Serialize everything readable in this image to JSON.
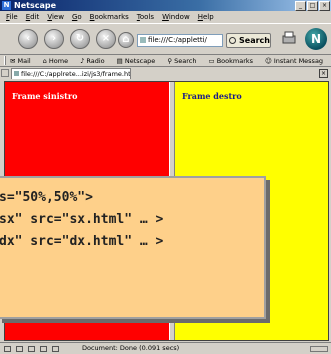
{
  "window": {
    "title": "Netscape"
  },
  "menubar": {
    "items": [
      "File",
      "Edit",
      "View",
      "Go",
      "Bookmarks",
      "Tools",
      "Window",
      "Help"
    ]
  },
  "navbar": {
    "url": "file:///C:/appletti/",
    "search_label": "Search",
    "logo_letter": "N"
  },
  "personal_toolbar": {
    "items": [
      "Mail",
      "Home",
      "Radio",
      "Netscape",
      "Search",
      "Bookmarks",
      "Instant Messag"
    ]
  },
  "tab": {
    "title": "file:///C:/applrete...izi/js3/frame.html"
  },
  "frames": {
    "left_title": "Frame sinistro",
    "right_title": "Frame destro",
    "left_color": "#ff0000",
    "right_color": "#ffff00"
  },
  "code": {
    "lines": [
      "s=\"50%,50%\">",
      "sx\" src=\"sx.html\" … >",
      "dx\" src=\"dx.html\" … >"
    ]
  },
  "statusbar": {
    "text": "Document: Done (0.091 secs)"
  }
}
